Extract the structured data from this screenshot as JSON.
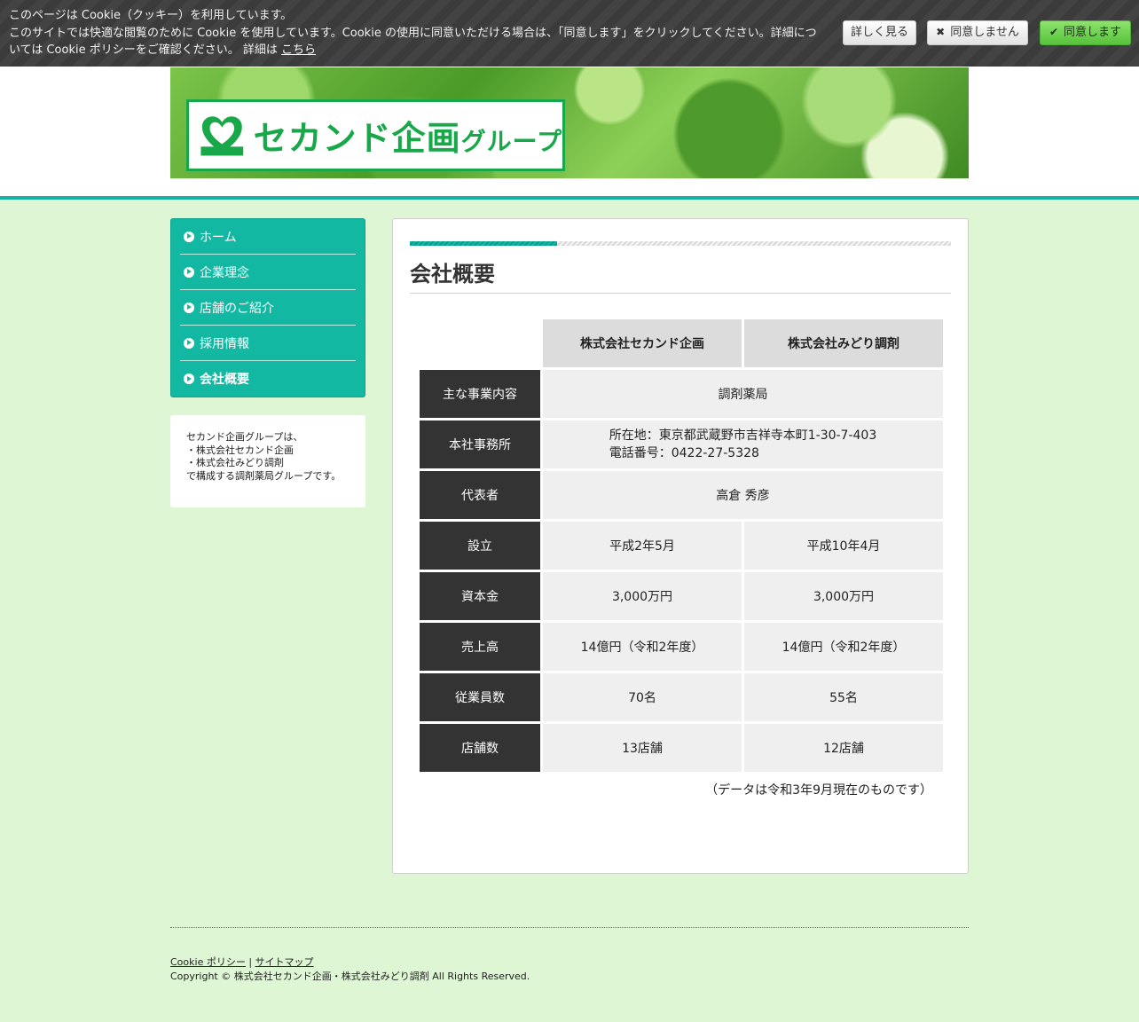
{
  "cookie": {
    "title": "このページは Cookie（クッキー）を利用しています。",
    "body": "このサイトでは快適な閲覧のために Cookie を使用しています。Cookie の使用に同意いただける場合は、「同意します」をクリックしてください。詳細については Cookie ポリシーをご確認ください。 詳細は",
    "link": "こちら",
    "detail_button": "詳しく見る",
    "deny_button": "同意しません",
    "agree_button": "同意します"
  },
  "logo": {
    "main": "セカンド企画",
    "sub": "グループ"
  },
  "nav": {
    "items": [
      {
        "label": "ホーム"
      },
      {
        "label": "企業理念"
      },
      {
        "label": "店舗のご紹介"
      },
      {
        "label": "採用情報"
      },
      {
        "label": "会社概要"
      }
    ]
  },
  "side_note": {
    "lines": [
      "セカンド企画グループは、",
      "・株式会社セカンド企画",
      "・株式会社みどり調剤",
      "で構成する調剤薬局グループです。"
    ]
  },
  "main": {
    "title": "会社概要",
    "col1": "株式会社セカンド企画",
    "col2": "株式会社みどり調剤",
    "rows": {
      "business": {
        "label": "主な事業内容",
        "value": "調剤薬局"
      },
      "office": {
        "label": "本社事務所",
        "address": "所在地：東京都武蔵野市吉祥寺本町1-30-7-403",
        "phone": "電話番号：0422-27-5328"
      },
      "rep": {
        "label": "代表者",
        "value": "高倉 秀彦"
      },
      "founded": {
        "label": "設立",
        "v1": "平成2年5月",
        "v2": "平成10年4月"
      },
      "capital": {
        "label": "資本金",
        "v1": "3,000万円",
        "v2": "3,000万円"
      },
      "sales": {
        "label": "売上高",
        "v1": "14億円（令和2年度）",
        "v2": "14億円（令和2年度）"
      },
      "employees": {
        "label": "従業員数",
        "v1": "70名",
        "v2": "55名"
      },
      "stores": {
        "label": "店舗数",
        "v1": "13店舗",
        "v2": "12店舗"
      }
    },
    "note": "（データは令和3年9月現在のものです）"
  },
  "footer": {
    "cookie_policy": "Cookie ポリシー",
    "separator": "|",
    "sitemap": "サイトマップ",
    "copyright": "Copyright © 株式会社セカンド企画・株式会社みどり調剤 All Rights Reserved."
  },
  "colors": {
    "accent": "#13b8a2",
    "background": "#dff6d4",
    "brand_green": "#18a84a"
  }
}
